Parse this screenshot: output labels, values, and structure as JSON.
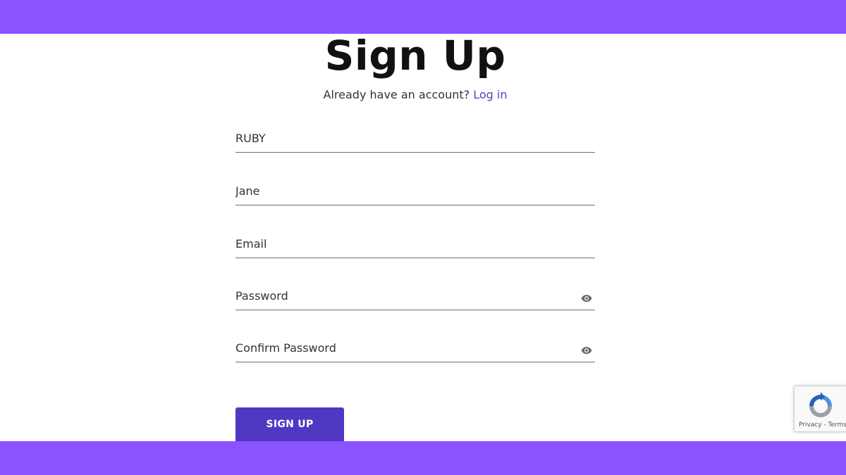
{
  "page": {
    "title": "Sign Up",
    "account_prompt": "Already have an account?",
    "login_link": "Log in"
  },
  "form": {
    "first_name": {
      "value": "",
      "placeholder": "RUBY"
    },
    "last_name": {
      "value": "",
      "placeholder": "Jane"
    },
    "email": {
      "value": "",
      "placeholder": "Email"
    },
    "password": {
      "value": "",
      "placeholder": "Password",
      "toggle_icon": "eye-icon"
    },
    "confirm_password": {
      "value": "",
      "placeholder": "Confirm Password",
      "toggle_icon": "eye-icon"
    },
    "submit_label": "SIGN UP"
  },
  "recaptcha": {
    "terms": "Privacy - Terms",
    "icon": "recaptcha-icon"
  },
  "colors": {
    "accent_band": "#8b52ff",
    "button": "#5038c2",
    "link": "#4f46b8"
  }
}
